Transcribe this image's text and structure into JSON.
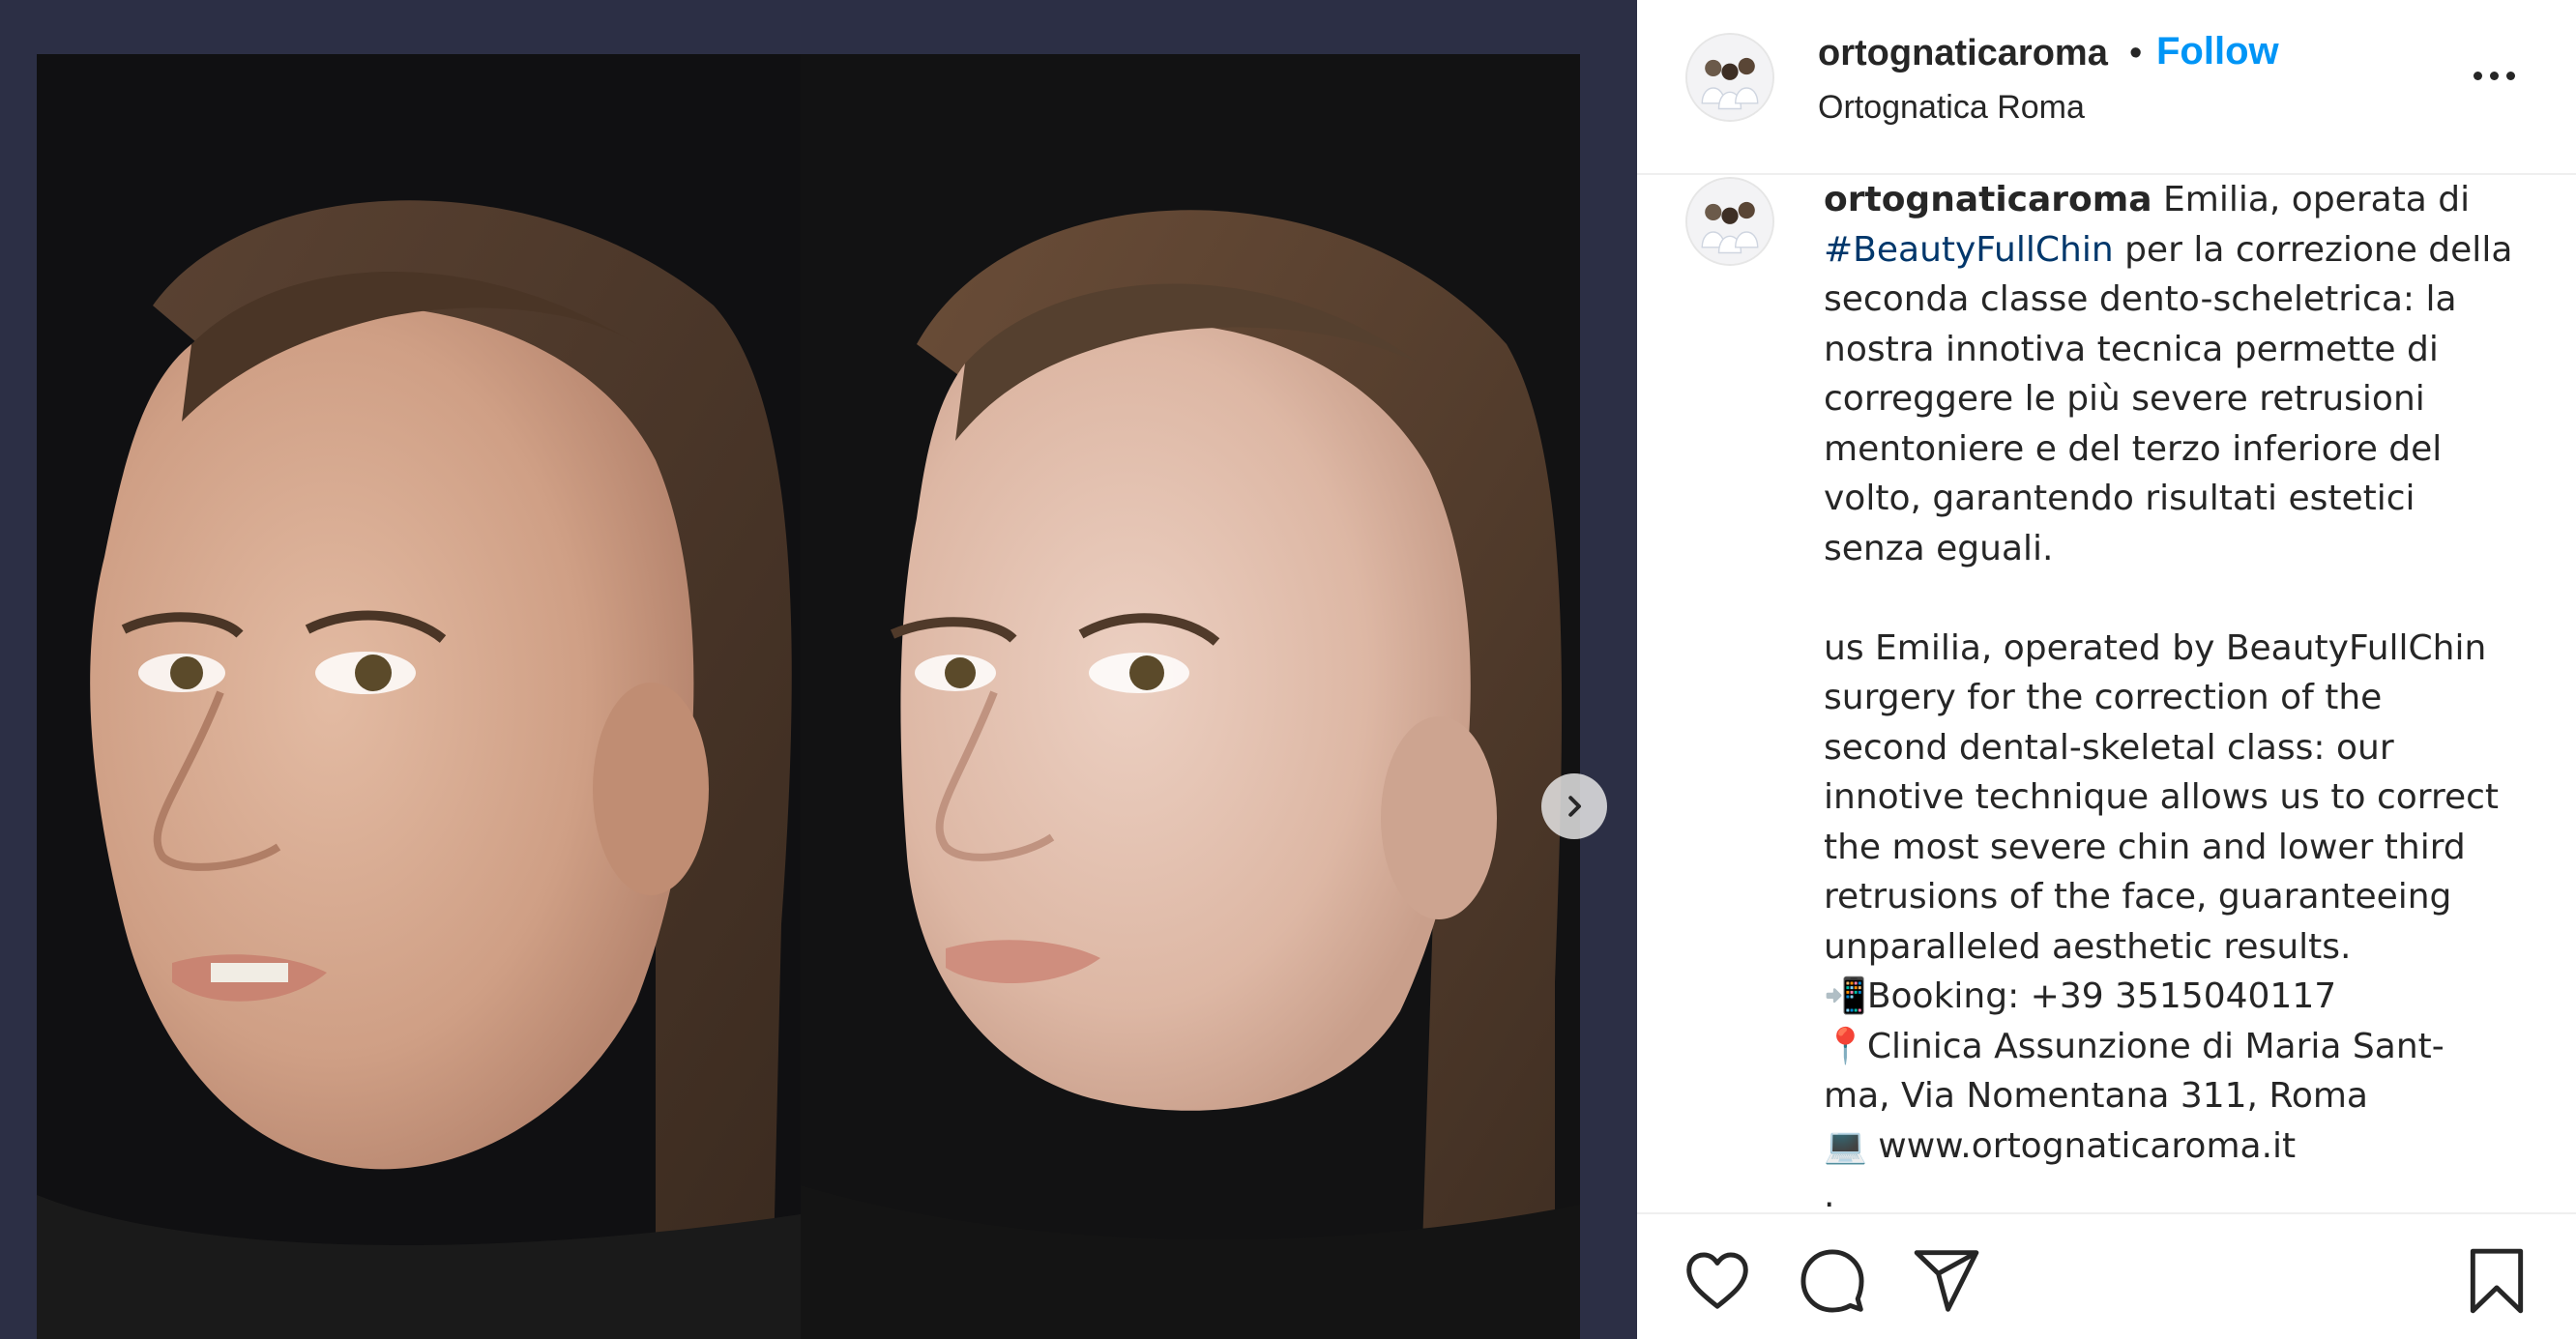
{
  "post": {
    "username": "ortognaticaroma",
    "separator": "•",
    "follow_label": "Follow",
    "location": "Ortognatica Roma",
    "more_icon": "more-horizontal-icon"
  },
  "media": {
    "before_alt": "before-profile-photo",
    "after_alt": "after-profile-photo",
    "next_icon": "chevron-right-icon"
  },
  "caption": {
    "username": "ortognaticaroma",
    "lines": {
      "l1": " Emilia, operata di",
      "l2_tag": "#BeautyFullChin",
      "l2_rest": " per la correzione della",
      "l3": "seconda classe dento-scheletrica: la",
      "l4": "nostra innotiva tecnica permette di",
      "l5": "correggere le più severe retrusioni",
      "l6": "mentoniere e del terzo inferiore del",
      "l7": "volto, garantendo risultati estetici",
      "l8": "senza eguali.",
      "l9": "us Emilia, operated by BeautyFullChin",
      "l10": "surgery for the correction of the",
      "l11": "second dental-skeletal class: our",
      "l12": "innotive technique allows us to correct",
      "l13": "the most severe chin and lower third",
      "l14": "retrusions of the face, guaranteeing",
      "l15": "unparalleled aesthetic results.",
      "l16": "📲Booking: +39 3515040117",
      "l17": "📍Clinica Assunzione di Maria Sant-",
      "l18": "ma, Via Nomentana 311, Roma",
      "l19": "💻 www.ortognaticaroma.it",
      "l20": "."
    }
  },
  "actions": {
    "like_icon": "heart-icon",
    "comment_icon": "comment-bubble-icon",
    "share_icon": "paper-plane-icon",
    "save_icon": "bookmark-icon"
  },
  "colors": {
    "follow": "#0095f6",
    "hashtag": "#00376b",
    "media_frame": "#2c2f45",
    "text": "#262626"
  }
}
